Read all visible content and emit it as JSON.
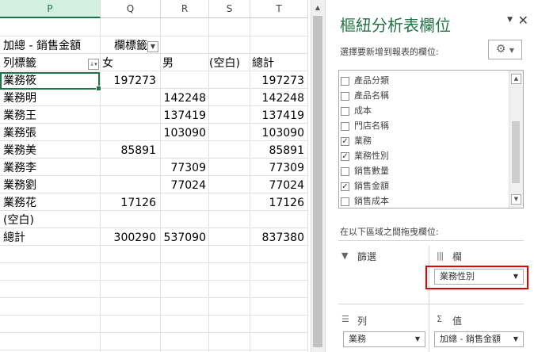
{
  "sheet": {
    "columns": [
      "P",
      "Q",
      "R",
      "S",
      "T"
    ],
    "selected_column": "P",
    "row1": {
      "label": "加總 - 銷售金額",
      "col_label": "欄標籤"
    },
    "header_row": {
      "row_label": "列標籤",
      "female": "女",
      "male": "男",
      "blank": "(空白)",
      "total": "總計"
    },
    "rows": [
      {
        "name": "業務筱",
        "female": "197273",
        "male": "",
        "total": "197273"
      },
      {
        "name": "業務明",
        "female": "",
        "male": "142248",
        "total": "142248"
      },
      {
        "name": "業務王",
        "female": "",
        "male": "137419",
        "total": "137419"
      },
      {
        "name": "業務張",
        "female": "",
        "male": "103090",
        "total": "103090"
      },
      {
        "name": "業務美",
        "female": "85891",
        "male": "",
        "total": "85891"
      },
      {
        "name": "業務李",
        "female": "",
        "male": "77309",
        "total": "77309"
      },
      {
        "name": "業務劉",
        "female": "",
        "male": "77024",
        "total": "77024"
      },
      {
        "name": "業務花",
        "female": "17126",
        "male": "",
        "total": "17126"
      },
      {
        "name": "(空白)",
        "female": "",
        "male": "",
        "total": ""
      },
      {
        "name": "總計",
        "female": "300290",
        "male": "537090",
        "total": "837380"
      }
    ]
  },
  "pane": {
    "title": "樞紐分析表欄位",
    "choose_label": "選擇要新增到報表的欄位:",
    "fields": [
      {
        "label": "產品分類",
        "checked": false
      },
      {
        "label": "產品名稱",
        "checked": false
      },
      {
        "label": "成本",
        "checked": false
      },
      {
        "label": "門店名稱",
        "checked": false
      },
      {
        "label": "業務",
        "checked": true
      },
      {
        "label": "業務性別",
        "checked": true
      },
      {
        "label": "銷售數量",
        "checked": false
      },
      {
        "label": "銷售金額",
        "checked": true
      },
      {
        "label": "銷售成本",
        "checked": false
      }
    ],
    "drag_label": "在以下區域之間拖曳欄位:",
    "areas": {
      "filters": {
        "title": "篩選"
      },
      "columns": {
        "title": "欄",
        "chip": "業務性別"
      },
      "rows": {
        "title": "列",
        "chip": "業務"
      },
      "values": {
        "title": "值",
        "chip": "加總 - 銷售金額"
      }
    }
  },
  "colors": {
    "accent": "#217346",
    "highlight": "#e00000"
  }
}
